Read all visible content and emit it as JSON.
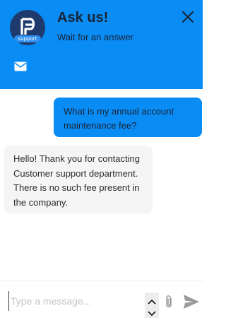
{
  "header": {
    "title": "Ask us!",
    "subtitle": "Wait for an answer",
    "avatar_tag": "support",
    "background_color": "#0a8cf5",
    "icons": {
      "close": "close-icon",
      "mail": "mail-icon"
    }
  },
  "messages": [
    {
      "sender": "user",
      "text": "What is my annual account maintenance fee?"
    },
    {
      "sender": "agent",
      "text": "Hello! Thank you for contacting Customer support department. There is no such fee present in the company."
    }
  ],
  "composer": {
    "placeholder": "Type a message...",
    "value": "",
    "icons": {
      "stepper_up": "chevron-up-icon",
      "stepper_down": "chevron-down-icon",
      "attach": "paperclip-icon",
      "send": "send-icon"
    }
  }
}
